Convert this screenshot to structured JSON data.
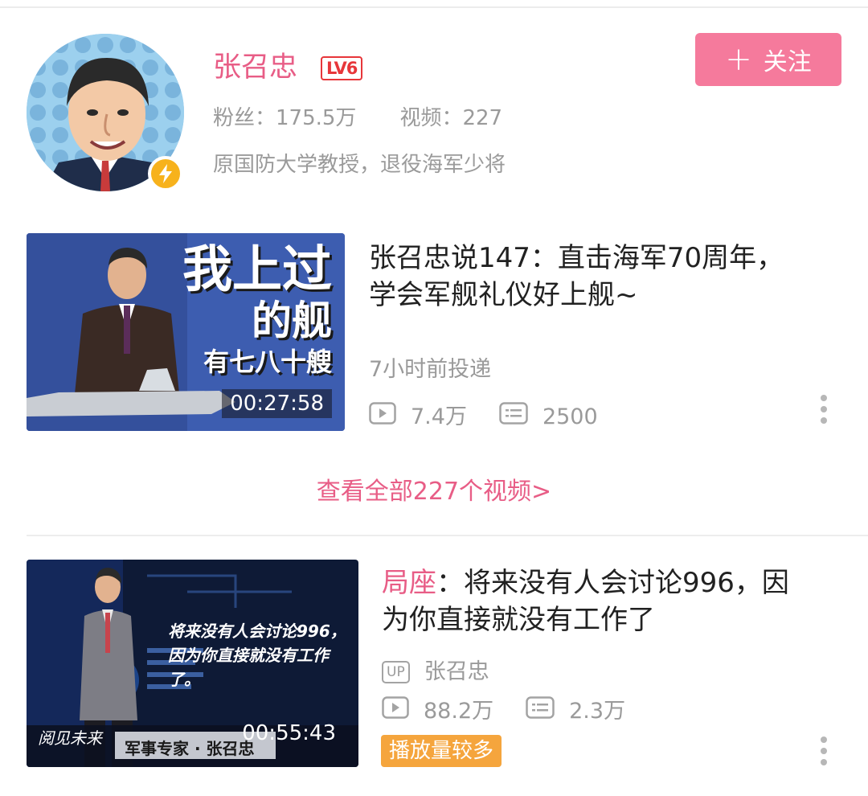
{
  "profile": {
    "name": "张召忠",
    "level": "LV6",
    "fans": "粉丝：175.5万",
    "videos": "视频：227",
    "bio": "原国防大学教授，退役海军少将",
    "follow_plus": "+",
    "follow_label": "关注"
  },
  "video1": {
    "title_line1": "张召忠说147：直击海军70周年，",
    "title_line2": "学会军舰礼仪好上舰~",
    "posted": "7小时前投递",
    "plays": "7.4万",
    "danmaku": "2500",
    "duration": "00:27:58",
    "thumb_text_1": "我上过",
    "thumb_text_2": "的舰",
    "thumb_text_3": "有七八十艘"
  },
  "view_all": "查看全部227个视频>",
  "video2": {
    "tag": "局座",
    "title_line1_rest": "：将来没有人会讨论996，因",
    "title_line2": "为你直接就没有工作了",
    "up_badge": "UP",
    "uploader": "张召忠",
    "plays": "88.2万",
    "danmaku": "2.3万",
    "hot_label": "播放量较多",
    "duration": "00:55:43",
    "thumb_quote_1": "将来没有人会讨论996，",
    "thumb_quote_2": "因为你直接就没有工作了。",
    "thumb_caption": "军事专家 · 张召忠",
    "thumb_logo": "阅见未来"
  },
  "colors": {
    "accent_pink": "#e85d86",
    "follow_bg": "#f57a9c",
    "level_red": "#e7363a",
    "hot_orange": "#f5a53d",
    "meta_gray": "#9a9a9a"
  }
}
